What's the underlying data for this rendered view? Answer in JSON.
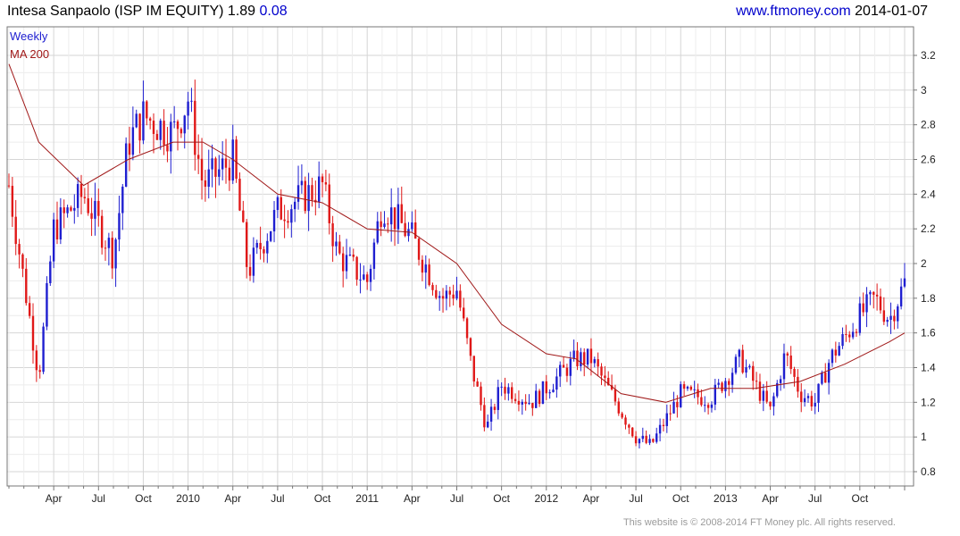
{
  "header": {
    "title": "Intesa Sanpaolo (ISP IM EQUITY) 1.89",
    "change": "0.08"
  },
  "site": {
    "url": "www.ftmoney.com",
    "date": "2014-01-07"
  },
  "footer": "This website is © 2008-2014 FT Money plc. All rights reserved.",
  "colors": {
    "up": "#1f1fd0",
    "down": "#e01818",
    "ma": "#a01818",
    "grid": "#d6d6d6"
  },
  "chart_data": {
    "type": "line",
    "title": "Intesa Sanpaolo (ISP IM EQUITY)",
    "legend": [
      "Weekly",
      "MA 200"
    ],
    "legend_position": "top-left",
    "grid": true,
    "ylim": [
      0.8,
      3.3
    ],
    "y_ticks": [
      "3.2",
      "3",
      "2.8",
      "2.6",
      "2.4",
      "2.2",
      "2",
      "1.8",
      "1.6",
      "1.4",
      "1.2",
      "1",
      "0.8"
    ],
    "x_ticks": [
      "Apr",
      "Jul",
      "Oct",
      "2010",
      "Apr",
      "Jul",
      "Oct",
      "2011",
      "Apr",
      "Jul",
      "Oct",
      "2012",
      "Apr",
      "Jul",
      "Oct",
      "2013",
      "Apr",
      "Jul",
      "Oct"
    ],
    "series": [
      {
        "name": "Weekly",
        "x": [
          "2009-01",
          "2009-03",
          "2009-04",
          "2009-06",
          "2009-08",
          "2009-09",
          "2009-10",
          "2009-12",
          "2010-01",
          "2010-02",
          "2010-04",
          "2010-05",
          "2010-07",
          "2010-09",
          "2010-10",
          "2010-11",
          "2011-01",
          "2011-02",
          "2011-04",
          "2011-06",
          "2011-07",
          "2011-08",
          "2011-09",
          "2011-10",
          "2011-12",
          "2012-03",
          "2012-04",
          "2012-06",
          "2012-07",
          "2012-08",
          "2012-10",
          "2012-12",
          "2013-02",
          "2013-03",
          "2013-04",
          "2013-05",
          "2013-06",
          "2013-07",
          "2013-08",
          "2013-10",
          "2013-11",
          "2013-12",
          "2014-01"
        ],
        "values": [
          2.45,
          1.35,
          2.2,
          2.4,
          2.05,
          2.7,
          2.85,
          2.75,
          2.95,
          2.45,
          2.6,
          1.95,
          2.3,
          2.4,
          2.45,
          2.05,
          1.9,
          2.35,
          2.15,
          1.8,
          1.85,
          1.4,
          1.05,
          1.3,
          1.2,
          1.45,
          1.45,
          1.15,
          1.0,
          0.95,
          1.25,
          1.22,
          1.45,
          1.3,
          1.15,
          1.48,
          1.25,
          1.2,
          1.45,
          1.7,
          1.8,
          1.68,
          1.89
        ]
      },
      {
        "name": "MA 200",
        "x": [
          "2009-01",
          "2009-03",
          "2009-06",
          "2009-09",
          "2009-12",
          "2010-02",
          "2010-04",
          "2010-07",
          "2010-10",
          "2011-01",
          "2011-04",
          "2011-07",
          "2011-10",
          "2012-01",
          "2012-03",
          "2012-06",
          "2012-09",
          "2012-12",
          "2013-03",
          "2013-06",
          "2013-09",
          "2013-12",
          "2014-01"
        ],
        "values": [
          3.15,
          2.7,
          2.45,
          2.6,
          2.7,
          2.7,
          2.6,
          2.4,
          2.35,
          2.2,
          2.18,
          2.0,
          1.65,
          1.48,
          1.45,
          1.25,
          1.2,
          1.28,
          1.28,
          1.32,
          1.42,
          1.55,
          1.6
        ]
      }
    ]
  }
}
